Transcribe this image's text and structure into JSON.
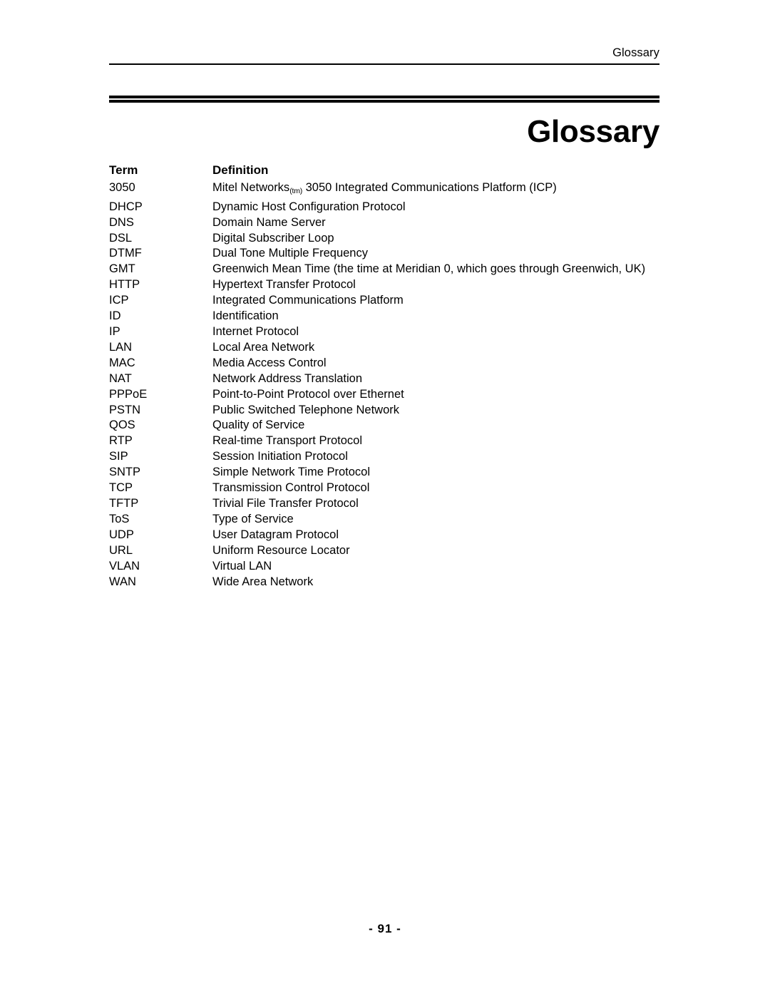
{
  "header": {
    "running_title": "Glossary"
  },
  "title": {
    "text": "Glossary"
  },
  "table": {
    "columns": {
      "term": "Term",
      "definition": "Definition"
    },
    "rows": [
      {
        "term": "3050",
        "definition_pre": "Mitel Networks",
        "definition_sup": "(tm)",
        "definition_post": " 3050 Integrated Communications Platform (ICP)"
      },
      {
        "term": "DHCP",
        "definition": "Dynamic Host Configuration Protocol"
      },
      {
        "term": "DNS",
        "definition": "Domain Name Server"
      },
      {
        "term": "DSL",
        "definition": "Digital Subscriber Loop"
      },
      {
        "term": "DTMF",
        "definition": "Dual Tone Multiple Frequency"
      },
      {
        "term": "GMT",
        "definition": "Greenwich Mean Time (the time at Meridian 0, which goes through Greenwich, UK)"
      },
      {
        "term": "HTTP",
        "definition": "Hypertext Transfer Protocol"
      },
      {
        "term": "ICP",
        "definition": "Integrated Communications Platform"
      },
      {
        "term": "ID",
        "definition": "Identification"
      },
      {
        "term": "IP",
        "definition": "Internet Protocol"
      },
      {
        "term": "LAN",
        "definition": "Local Area Network"
      },
      {
        "term": "MAC",
        "definition": "Media Access Control"
      },
      {
        "term": "NAT",
        "definition": "Network Address Translation"
      },
      {
        "term": "PPPoE",
        "definition": "Point-to-Point Protocol over Ethernet"
      },
      {
        "term": "PSTN",
        "definition": "Public Switched Telephone Network"
      },
      {
        "term": "QOS",
        "definition": "Quality of Service"
      },
      {
        "term": "RTP",
        "definition": "Real-time Transport Protocol"
      },
      {
        "term": "SIP",
        "definition": "Session Initiation Protocol"
      },
      {
        "term": "SNTP",
        "definition": "Simple Network Time Protocol"
      },
      {
        "term": "TCP",
        "definition": "Transmission Control Protocol"
      },
      {
        "term": "TFTP",
        "definition": "Trivial File Transfer Protocol"
      },
      {
        "term": "ToS",
        "definition": "Type of Service"
      },
      {
        "term": "UDP",
        "definition": "User Datagram Protocol"
      },
      {
        "term": "URL",
        "definition": "Uniform Resource Locator"
      },
      {
        "term": "VLAN",
        "definition": "Virtual LAN"
      },
      {
        "term": "WAN",
        "definition": "Wide Area Network"
      }
    ]
  },
  "footer": {
    "page_number": "- 91 -"
  },
  "colors": {
    "text": "#000000",
    "page_background": "#ffffff",
    "rule": "#000000"
  }
}
